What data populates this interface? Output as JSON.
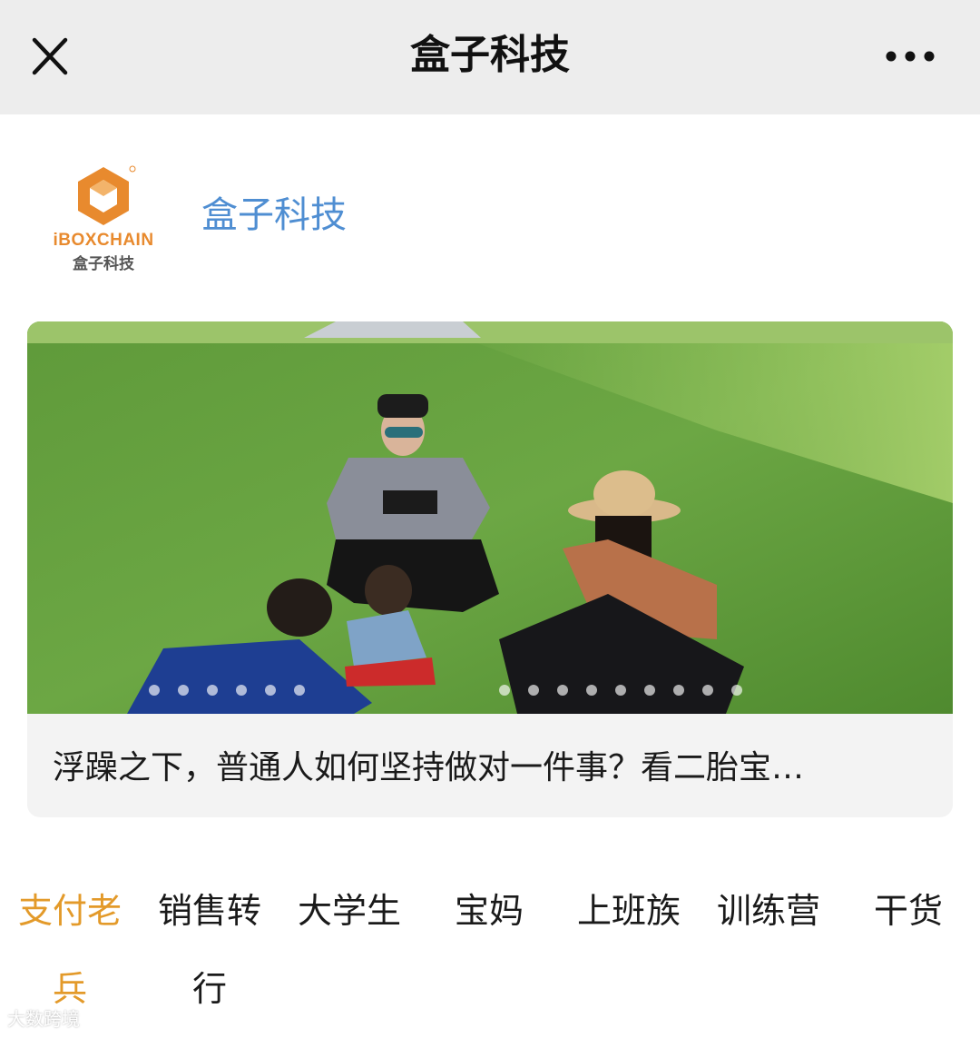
{
  "topbar": {
    "title": "盒子科技",
    "close_icon": "close-icon",
    "more_icon": "more-icon"
  },
  "profile": {
    "logo_text": "iBOXCHAIN",
    "logo_sub": "盒子科技",
    "account_name": "盒子科技"
  },
  "article": {
    "caption": "浮躁之下，普通人如何坚持做对一件事？看二胎宝…"
  },
  "tabs": [
    {
      "line1": "支付老",
      "line2": "兵",
      "active": true
    },
    {
      "line1": "销售转",
      "line2": "行",
      "active": false
    },
    {
      "line1": "大学生",
      "line2": "",
      "active": false
    },
    {
      "line1": "宝妈",
      "line2": "",
      "active": false
    },
    {
      "line1": "上班族",
      "line2": "",
      "active": false
    },
    {
      "line1": "训练营",
      "line2": "",
      "active": false
    },
    {
      "line1": "干货",
      "line2": "",
      "active": false
    }
  ],
  "watermark": "大数跨境",
  "colors": {
    "accent": "#e39a2a",
    "link": "#4f8ed2",
    "logo_orange": "#e88a2e",
    "topbar_bg": "#ededed"
  }
}
